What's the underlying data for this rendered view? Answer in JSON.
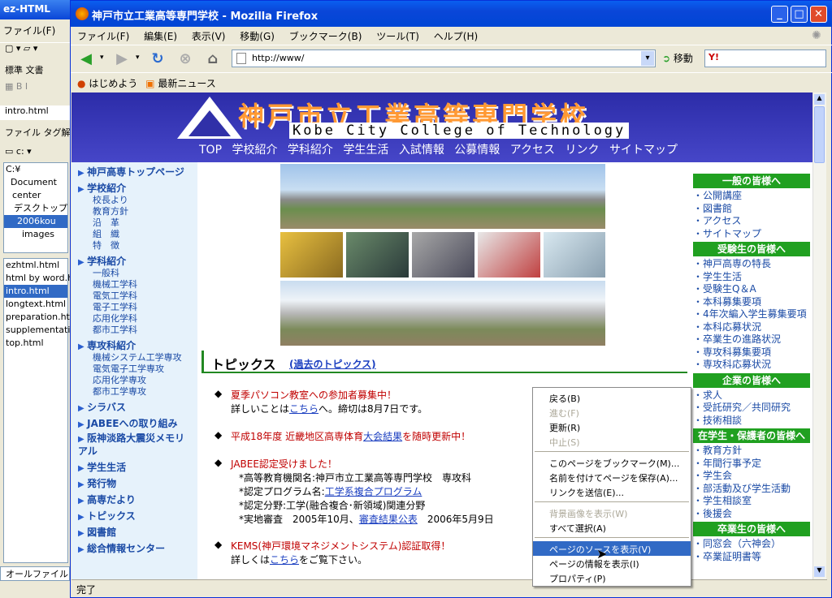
{
  "bg_app": {
    "title": "ez-HTML",
    "menu": "ファイル(F)",
    "tab1": "標準",
    "tab2": "文書",
    "file_tab": "intro.html",
    "panel_tabs": [
      "ファイル",
      "タグ解析"
    ],
    "drive": "c:",
    "tree": [
      "C:¥",
      "Document",
      "center",
      "デスクトップ",
      "2006kou",
      "images"
    ],
    "files": [
      "ezhtml.html",
      "html by word.ht",
      "intro.html",
      "longtext.html",
      "preparation.htm",
      "supplementatio",
      "top.html"
    ],
    "filter": "オールファイル(*.*)"
  },
  "browser": {
    "title": "神戸市立工業高等専門学校 - Mozilla Firefox",
    "menu": [
      "ファイル(F)",
      "編集(E)",
      "表示(V)",
      "移動(G)",
      "ブックマーク(B)",
      "ツール(T)",
      "ヘルプ(H)"
    ],
    "url": "http://www/",
    "go_label": "移動",
    "search_logo": "Y!",
    "bookmarks": [
      "はじめよう",
      "最新ニュース"
    ],
    "status": "完了"
  },
  "page": {
    "school_name": "神戸市立工業高等専門学校",
    "school_en": "Kobe City College of Technology",
    "topnav": [
      "TOP",
      "学校紹介",
      "学科紹介",
      "学生生活",
      "入試情報",
      "公募情報",
      "アクセス",
      "リンク",
      "サイトマップ"
    ],
    "left_nav": [
      {
        "h": "神戸高専トップページ",
        "s": []
      },
      {
        "h": "学校紹介",
        "s": [
          "校長より",
          "教育方針",
          "沿　革",
          "組　織",
          "特　徴"
        ]
      },
      {
        "h": "学科紹介",
        "s": [
          "一般科",
          "機械工学科",
          "電気工学科",
          "電子工学科",
          "応用化学科",
          "都市工学科"
        ]
      },
      {
        "h": "専攻科紹介",
        "s": [
          "機械システム工学専攻",
          "電気電子工学専攻",
          "応用化学専攻",
          "都市工学専攻"
        ]
      },
      {
        "h": "シラバス",
        "s": []
      },
      {
        "h": "JABEEへの取り組み",
        "s": []
      },
      {
        "h": "阪神淡路大震災メモリアル",
        "s": []
      },
      {
        "h": "学生生活",
        "s": []
      },
      {
        "h": "発行物",
        "s": []
      },
      {
        "h": "高専だより",
        "s": []
      },
      {
        "h": "トピックス",
        "s": []
      },
      {
        "h": "図書館",
        "s": []
      },
      {
        "h": "総合情報センター",
        "s": []
      }
    ],
    "right_nav": [
      {
        "h": "一般の皆様へ",
        "s": [
          "公開講座",
          "図書館",
          "アクセス",
          "サイトマップ"
        ]
      },
      {
        "h": "受験生の皆様へ",
        "s": [
          "神戸高専の特長",
          "学生生活",
          "受験生Q＆A",
          "本科募集要項",
          "4年次編入学生募集要項",
          "本科応募状況",
          "卒業生の進路状況",
          "専攻科募集要項",
          "専攻科応募状況"
        ]
      },
      {
        "h": "企業の皆様へ",
        "s": [
          "求人",
          "受託研究／共同研究",
          "技術相談"
        ]
      },
      {
        "h": "在学生・保護者の皆様へ",
        "s": [
          "教育方針",
          "年間行事予定",
          "学生会",
          "部活動及び学生活動",
          "学生相談室",
          "後援会"
        ]
      },
      {
        "h": "卒業生の皆様へ",
        "s": [
          "同窓会（六神会）",
          "卒業証明書等"
        ]
      }
    ],
    "topics_title": "トピックス",
    "topics_link": "(過去のトピックス)",
    "topics": {
      "t1": "夏季パソコン教室への参加者募集中！",
      "t1_pre": "詳しいことは",
      "t1_link": "こちら",
      "t1_post": "へ。締切は8月7日です。",
      "t2_pre": "平成18年度 近畿地区高専体育",
      "t2_link": "大会結果",
      "t2_post": "を随時更新中！",
      "t3": "JABEE認定受けました！",
      "t3_l1": "*高等教育機関名:神戸市立工業高等専門学校　専攻科",
      "t3_l2_pre": "*認定プログラム名:",
      "t3_l2_link": "工学系複合プログラム",
      "t3_l3": "*認定分野:工学(融合複合･新領域)関連分野",
      "t3_l4_pre": "*実地審査　2005年10月、",
      "t3_l4_link": "審査結果公表",
      "t3_l4_post": "　2006年5月9日",
      "t4": "KEMS(神戸環境マネジメントシステム)認証取得！",
      "t4_pre": "詳しくは",
      "t4_link": "こちら",
      "t4_post": "をご覧下さい。"
    }
  },
  "context_menu": [
    {
      "label": "戻る(B)",
      "state": "normal"
    },
    {
      "label": "進む(F)",
      "state": "disabled"
    },
    {
      "label": "更新(R)",
      "state": "normal"
    },
    {
      "label": "中止(S)",
      "state": "disabled"
    },
    {
      "label": "このページをブックマーク(M)...",
      "state": "normal"
    },
    {
      "label": "名前を付けてページを保存(A)...",
      "state": "normal"
    },
    {
      "label": "リンクを送信(E)...",
      "state": "normal"
    },
    {
      "label": "背景画像を表示(W)",
      "state": "disabled"
    },
    {
      "label": "すべて選択(A)",
      "state": "normal"
    },
    {
      "label": "ページのソースを表示(V)",
      "state": "highlighted"
    },
    {
      "label": "ページの情報を表示(I)",
      "state": "normal"
    },
    {
      "label": "プロパティ(P)",
      "state": "normal"
    }
  ]
}
